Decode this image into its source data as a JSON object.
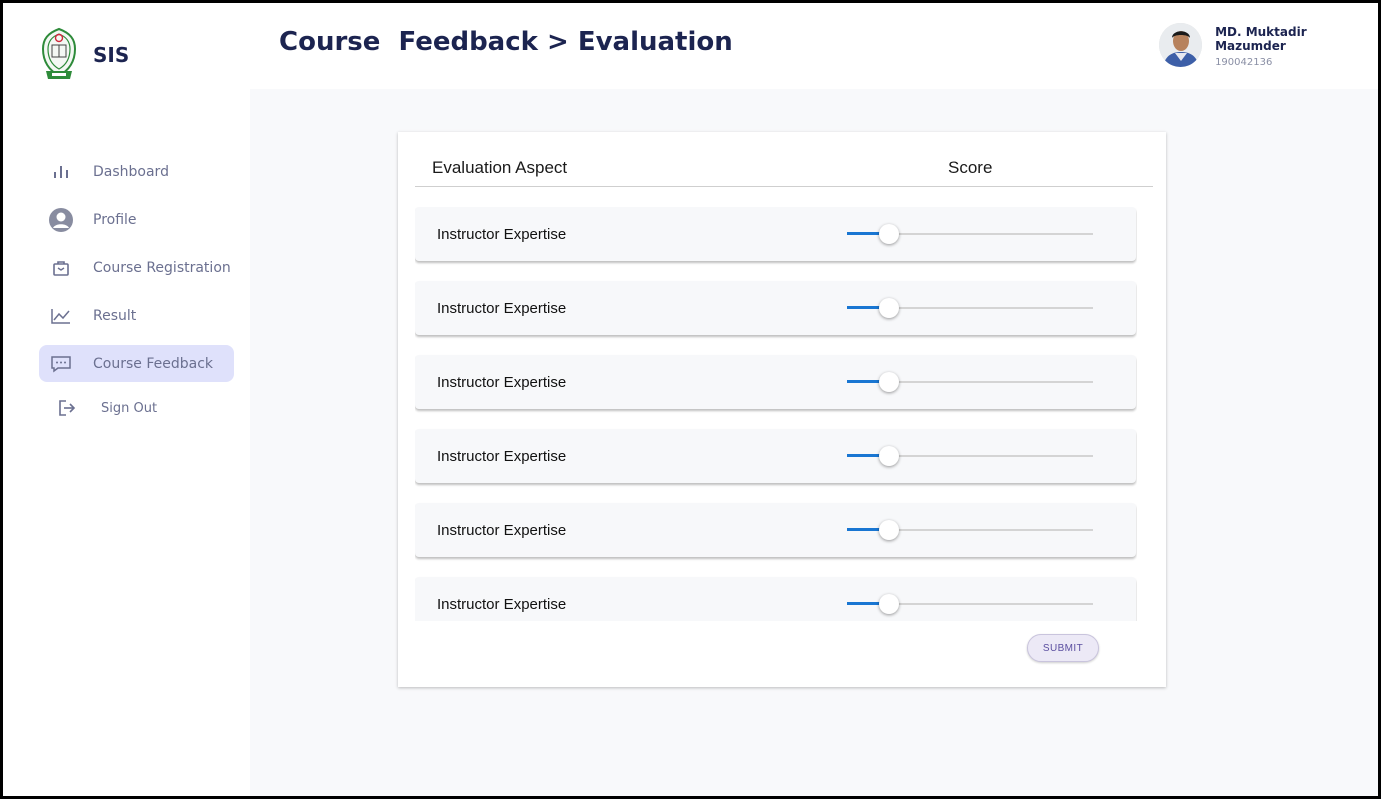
{
  "app": {
    "name": "SIS"
  },
  "header": {
    "title": "Course  Feedback > Evaluation",
    "user": {
      "name": "MD. Muktadir Mazumder",
      "id": "190042136"
    }
  },
  "sidebar": {
    "items": [
      {
        "label": "Dashboard",
        "icon": "bar-chart-icon"
      },
      {
        "label": "Profile",
        "icon": "user-circle-icon"
      },
      {
        "label": "Course Registration",
        "icon": "bag-icon"
      },
      {
        "label": "Result",
        "icon": "line-chart-icon"
      },
      {
        "label": "Course Feedback",
        "icon": "chat-icon",
        "active": true
      },
      {
        "label": "Sign Out",
        "icon": "sign-out-icon"
      }
    ]
  },
  "evaluation": {
    "headers": {
      "aspect": "Evaluation Aspect",
      "score": "Score"
    },
    "rows": [
      {
        "aspect": "Instructor Expertise",
        "score_fraction": 0.17
      },
      {
        "aspect": "Instructor Expertise",
        "score_fraction": 0.17
      },
      {
        "aspect": "Instructor Expertise",
        "score_fraction": 0.17
      },
      {
        "aspect": "Instructor Expertise",
        "score_fraction": 0.17
      },
      {
        "aspect": "Instructor Expertise",
        "score_fraction": 0.17
      },
      {
        "aspect": "Instructor Expertise",
        "score_fraction": 0.17
      }
    ],
    "submit_label": "SUBMIT"
  },
  "colors": {
    "accent": "#1976d2",
    "nav_active_bg": "#dfe1fb",
    "title": "#1c2450"
  }
}
